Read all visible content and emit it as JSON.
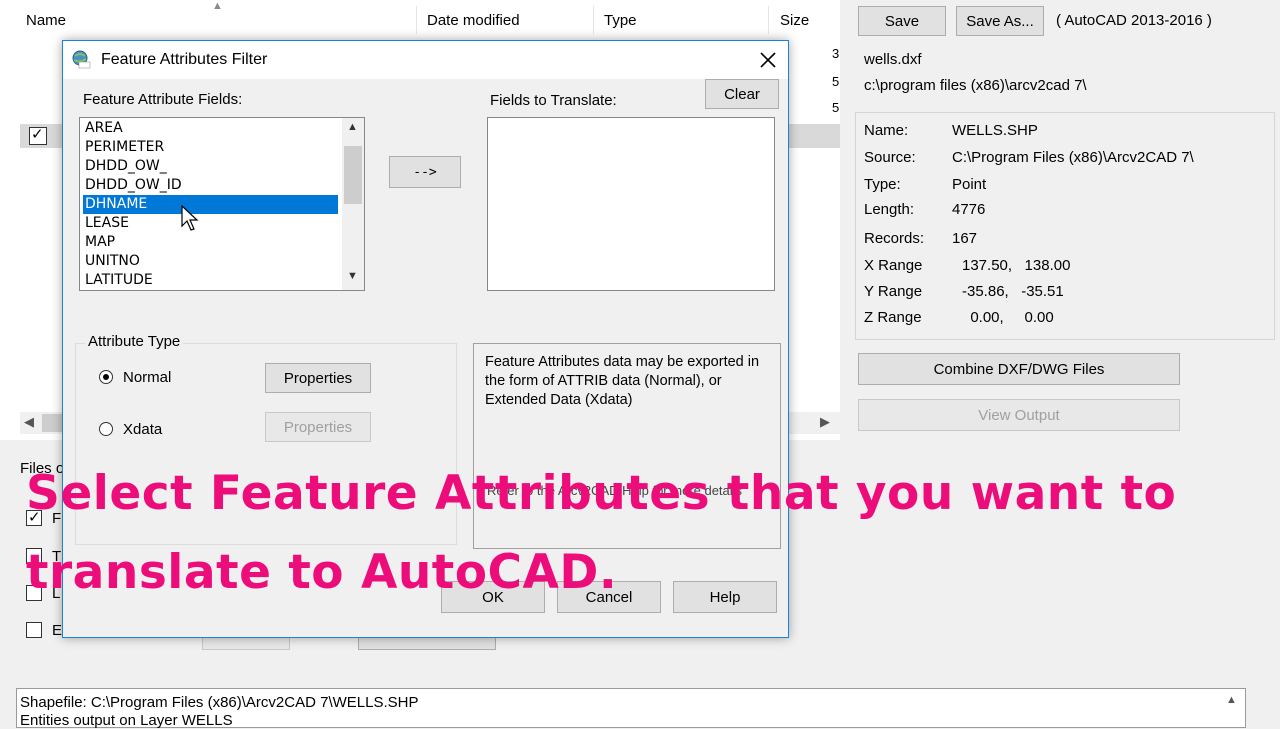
{
  "explorer": {
    "columns": {
      "name": "Name",
      "date_modified": "Date modified",
      "type": "Type",
      "size": "Size"
    },
    "size_digits": [
      "3",
      "5",
      "5"
    ],
    "files_of_label": "Files o",
    "bottom_checkbox_labels": [
      "F",
      "T",
      "L",
      "E"
    ],
    "status_line1": "Shapefile: C:\\Program Files (x86)\\Arcv2CAD 7\\WELLS.SHP",
    "status_line2": "Entities output on Layer WELLS"
  },
  "right_panel": {
    "save_label": "Save",
    "save_as_label": "Save As...",
    "format_label": "( AutoCAD 2013-2016 )",
    "output_file": "wells.dxf",
    "output_path": "c:\\program files (x86)\\arcv2cad 7\\",
    "info": {
      "name_label": "Name:",
      "name_value": "WELLS.SHP",
      "source_label": "Source:",
      "source_value": "C:\\Program Files (x86)\\Arcv2CAD 7\\",
      "type_label": "Type:",
      "type_value": "Point",
      "length_label": "Length:",
      "length_value": "4776",
      "records_label": "Records:",
      "records_value": "167",
      "xrange_label": "X Range",
      "xrange_value": "137.50,   138.00",
      "yrange_label": "Y Range",
      "yrange_value": "-35.86,   -35.51",
      "zrange_label": "Z Range",
      "zrange_value": "  0.00,     0.00"
    },
    "combine_label": "Combine DXF/DWG Files",
    "view_output_label": "View Output"
  },
  "dialog": {
    "title": "Feature Attributes Filter",
    "fields_label": "Feature Attribute Fields:",
    "fields": [
      "AREA",
      "PERIMETER",
      "DHDD_OW_",
      "DHDD_OW_ID",
      "DHNAME",
      "LEASE",
      "MAP",
      "UNITNO",
      "LATITUDE"
    ],
    "selected_index": 4,
    "arrow_label": "-->",
    "translate_label": "Fields to Translate:",
    "clear_label": "Clear",
    "attr_type_label": "Attribute Type",
    "normal_label": "Normal",
    "xdata_label": "Xdata",
    "properties_label": "Properties",
    "description": "Feature Attributes data may be exported in the form of ATTRIB data (Normal), or Extended Data (Xdata)",
    "help_hint": "Refer to the Arcv2CAD Help for more details",
    "ok_label": "OK",
    "cancel_label": "Cancel",
    "help_label": "Help"
  },
  "overlay": {
    "line1": "Select Feature Attributes that you want to",
    "line2": "translate to AutoCAD."
  },
  "colors": {
    "accent": "#0078d7",
    "overlay_text": "#ec0c7a",
    "dialog_border": "#1883d7"
  }
}
